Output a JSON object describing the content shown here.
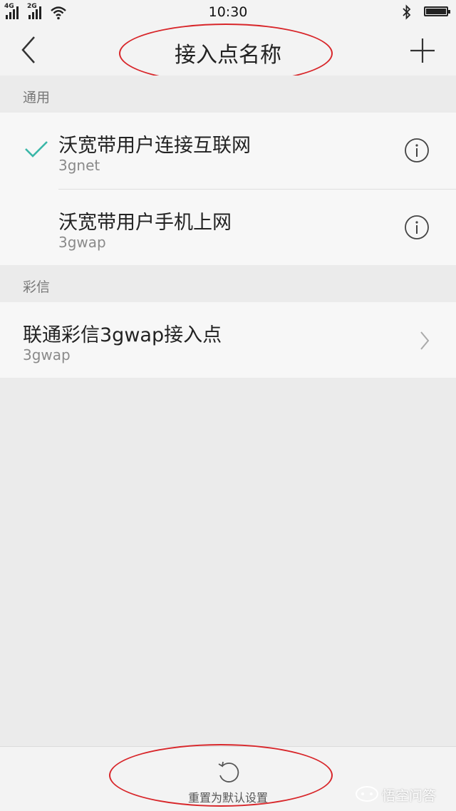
{
  "status_bar": {
    "network_1": "4G",
    "network_2": "2G",
    "time": "10:30"
  },
  "header": {
    "title": "接入点名称"
  },
  "sections": [
    {
      "header": "通用",
      "items": [
        {
          "title": "沃宽带用户连接互联网",
          "subtitle": "3gnet",
          "selected": true
        },
        {
          "title": "沃宽带用户手机上网",
          "subtitle": "3gwap",
          "selected": false
        }
      ]
    },
    {
      "header": "彩信",
      "items": [
        {
          "title": "联通彩信3gwap接入点",
          "subtitle": "3gwap"
        }
      ]
    }
  ],
  "footer": {
    "reset_label": "重置为默认设置"
  },
  "watermark": {
    "text": "悟空问答"
  },
  "colors": {
    "accent_check": "#3ab7a8",
    "annotation": "#d8262a"
  }
}
